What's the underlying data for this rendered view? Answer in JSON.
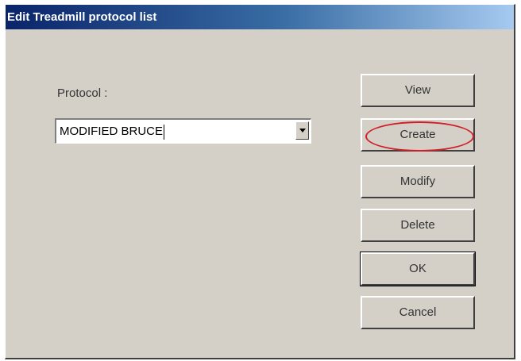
{
  "window": {
    "title": "Edit Treadmill protocol list"
  },
  "form": {
    "protocol_label": "Protocol :",
    "protocol_value": "MODIFIED BRUCE"
  },
  "buttons": {
    "view": "View",
    "create": "Create",
    "modify": "Modify",
    "delete": "Delete",
    "ok": "OK",
    "cancel": "Cancel"
  },
  "annotation": {
    "highlighted_button": "create",
    "highlight_color": "#d11f2a"
  },
  "icons": {
    "combo_dropdown": "chevron-down-icon"
  },
  "colors": {
    "dialog_face": "#d4d0c8",
    "titlebar_start": "#0a246a",
    "titlebar_end": "#a6caf0"
  }
}
